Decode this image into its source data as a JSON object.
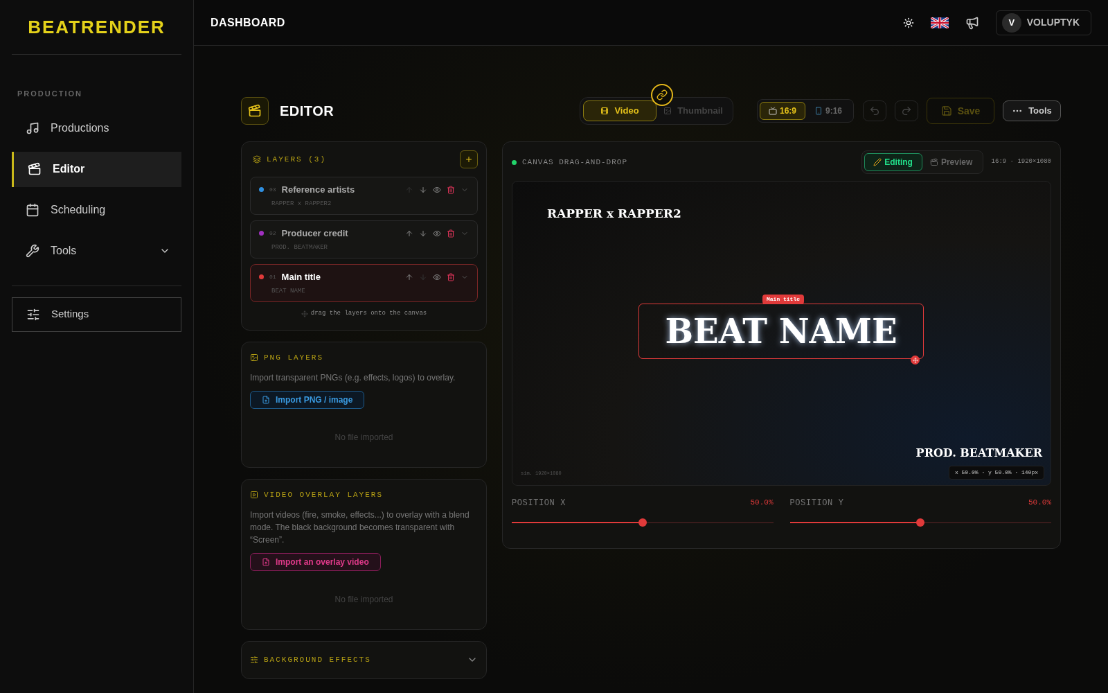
{
  "brand": "BEATRENDER",
  "header": {
    "title": "DASHBOARD",
    "user": {
      "initial": "V",
      "name": "VOLUPTYK"
    }
  },
  "sidebar": {
    "section": "PRODUCTION",
    "items": [
      {
        "label": "Productions",
        "kind": "music",
        "selected": false
      },
      {
        "label": "Editor",
        "kind": "editor",
        "selected": true
      },
      {
        "label": "Scheduling",
        "kind": "calendar",
        "selected": false
      },
      {
        "label": "Tools",
        "kind": "tools",
        "selected": false,
        "expanded": false
      }
    ],
    "settings": "Settings"
  },
  "editor": {
    "title": "EDITOR",
    "modes": [
      {
        "label": "Video",
        "kind": "video",
        "selected": true
      },
      {
        "label": "Thumbnail",
        "kind": "image",
        "selected": false
      }
    ],
    "ratios": [
      {
        "label": "16:9",
        "kind": "tv",
        "selected": true
      },
      {
        "label": "9:16",
        "kind": "phone",
        "selected": false
      }
    ],
    "save": {
      "label": "Save",
      "disabled": true
    },
    "tools": "Tools"
  },
  "layers": {
    "title": "LAYERS (3)",
    "items": [
      {
        "number": "03",
        "name": "Reference artists",
        "text": "RAPPER x RAPPER2",
        "color": "#2f8fe0",
        "selected": false,
        "up_disabled": true,
        "down_disabled": false
      },
      {
        "number": "02",
        "name": "Producer credit",
        "text": "PROD. BEATMAKER",
        "color": "#a030c0",
        "selected": false,
        "up_disabled": false,
        "down_disabled": false
      },
      {
        "number": "01",
        "name": "Main title",
        "text": "BEAT NAME",
        "color": "#e03a3a",
        "selected": true,
        "up_disabled": false,
        "down_disabled": true
      }
    ],
    "hint": "drag the layers onto the canvas"
  },
  "png_layers": {
    "title": "PNG LAYERS",
    "description": "Import transparent PNGs (e.g. effects, logos) to overlay.",
    "button": "Import PNG / image",
    "empty": "No file imported"
  },
  "video_layers": {
    "title": "VIDEO OVERLAY LAYERS",
    "description": "Import videos (fire, smoke, effects...) to overlay with a blend mode. The black background becomes transparent with “Screen”.",
    "button": "Import an overlay video",
    "empty": "No file imported"
  },
  "background_effects": {
    "title": "BACKGROUND EFFECTS",
    "expanded": false
  },
  "canvas": {
    "label": "CANVAS DRAG-AND-DROP",
    "views": [
      {
        "label": "Editing",
        "kind": "edit",
        "selected": true
      },
      {
        "label": "Preview",
        "kind": "preview",
        "selected": false
      }
    ],
    "info": "16:9 · 1920×1080",
    "reference": "RAPPER x RAPPER2",
    "main_title": "BEAT NAME",
    "tag": "Main title",
    "producer": "PROD. BEATMAKER",
    "sim": "sim. 1920×1080",
    "coords": "x 50.0% · y 50.0% · 140px"
  },
  "sliders": [
    {
      "label": "POSITION X",
      "reading": "50.0%",
      "level": 0.5
    },
    {
      "label": "POSITION Y",
      "reading": "50.0%",
      "level": 0.5
    }
  ]
}
